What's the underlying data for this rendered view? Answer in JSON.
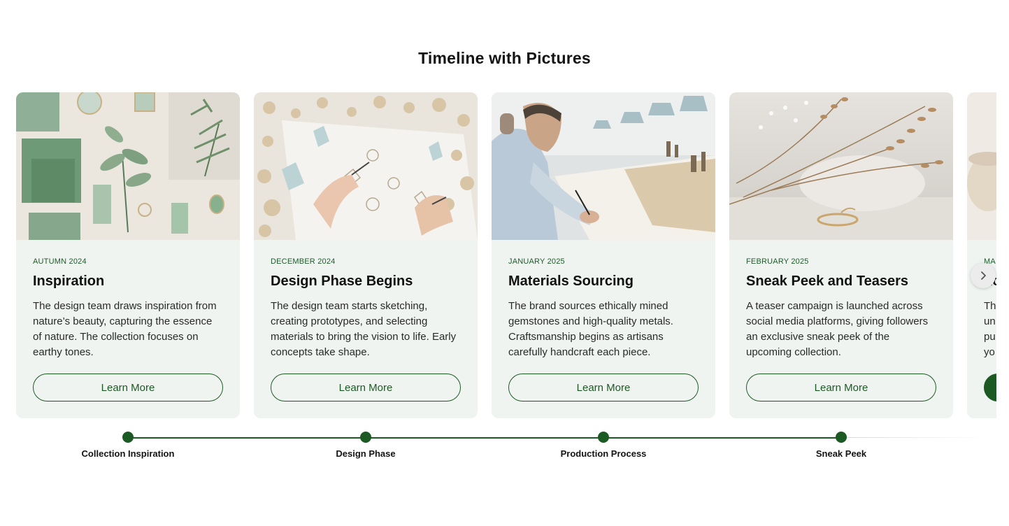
{
  "page": {
    "title": "Timeline with Pictures"
  },
  "cards": [
    {
      "date": "AUTUMN 2024",
      "title": "Inspiration",
      "description": "The design team draws inspiration from nature’s beauty, capturing the essence of nature. The collection focuses on earthy tones.",
      "button_label": "Learn More"
    },
    {
      "date": "DECEMBER 2024",
      "title": "Design Phase Begins",
      "description": "The design team starts sketching, creating prototypes, and selecting materials to bring the vision to life. Early concepts take shape.",
      "button_label": "Learn More"
    },
    {
      "date": "JANUARY 2025",
      "title": "Materials Sourcing",
      "description": "The brand sources ethically mined gemstones and high-quality metals. Craftsmanship begins as artisans carefully handcraft each piece.",
      "button_label": "Learn More"
    },
    {
      "date": "FEBRUARY 2025",
      "title": "Sneak Peek and Teasers",
      "description": "A teaser campaign is launched across social media platforms, giving followers an exclusive sneak peek of the upcoming collection.",
      "button_label": "Learn More"
    },
    {
      "date": "MA",
      "title": "Lo",
      "description": "Th un pu yo"
    }
  ],
  "timeline": {
    "milestones": [
      "Collection Inspiration",
      "Design Phase",
      "Production Process",
      "Sneak Peek"
    ]
  },
  "icons": {
    "next": "chevron-right-icon"
  },
  "colors": {
    "accent": "#1c5a24",
    "card_background": "#eff4f0",
    "page_background": "#ffffff"
  }
}
